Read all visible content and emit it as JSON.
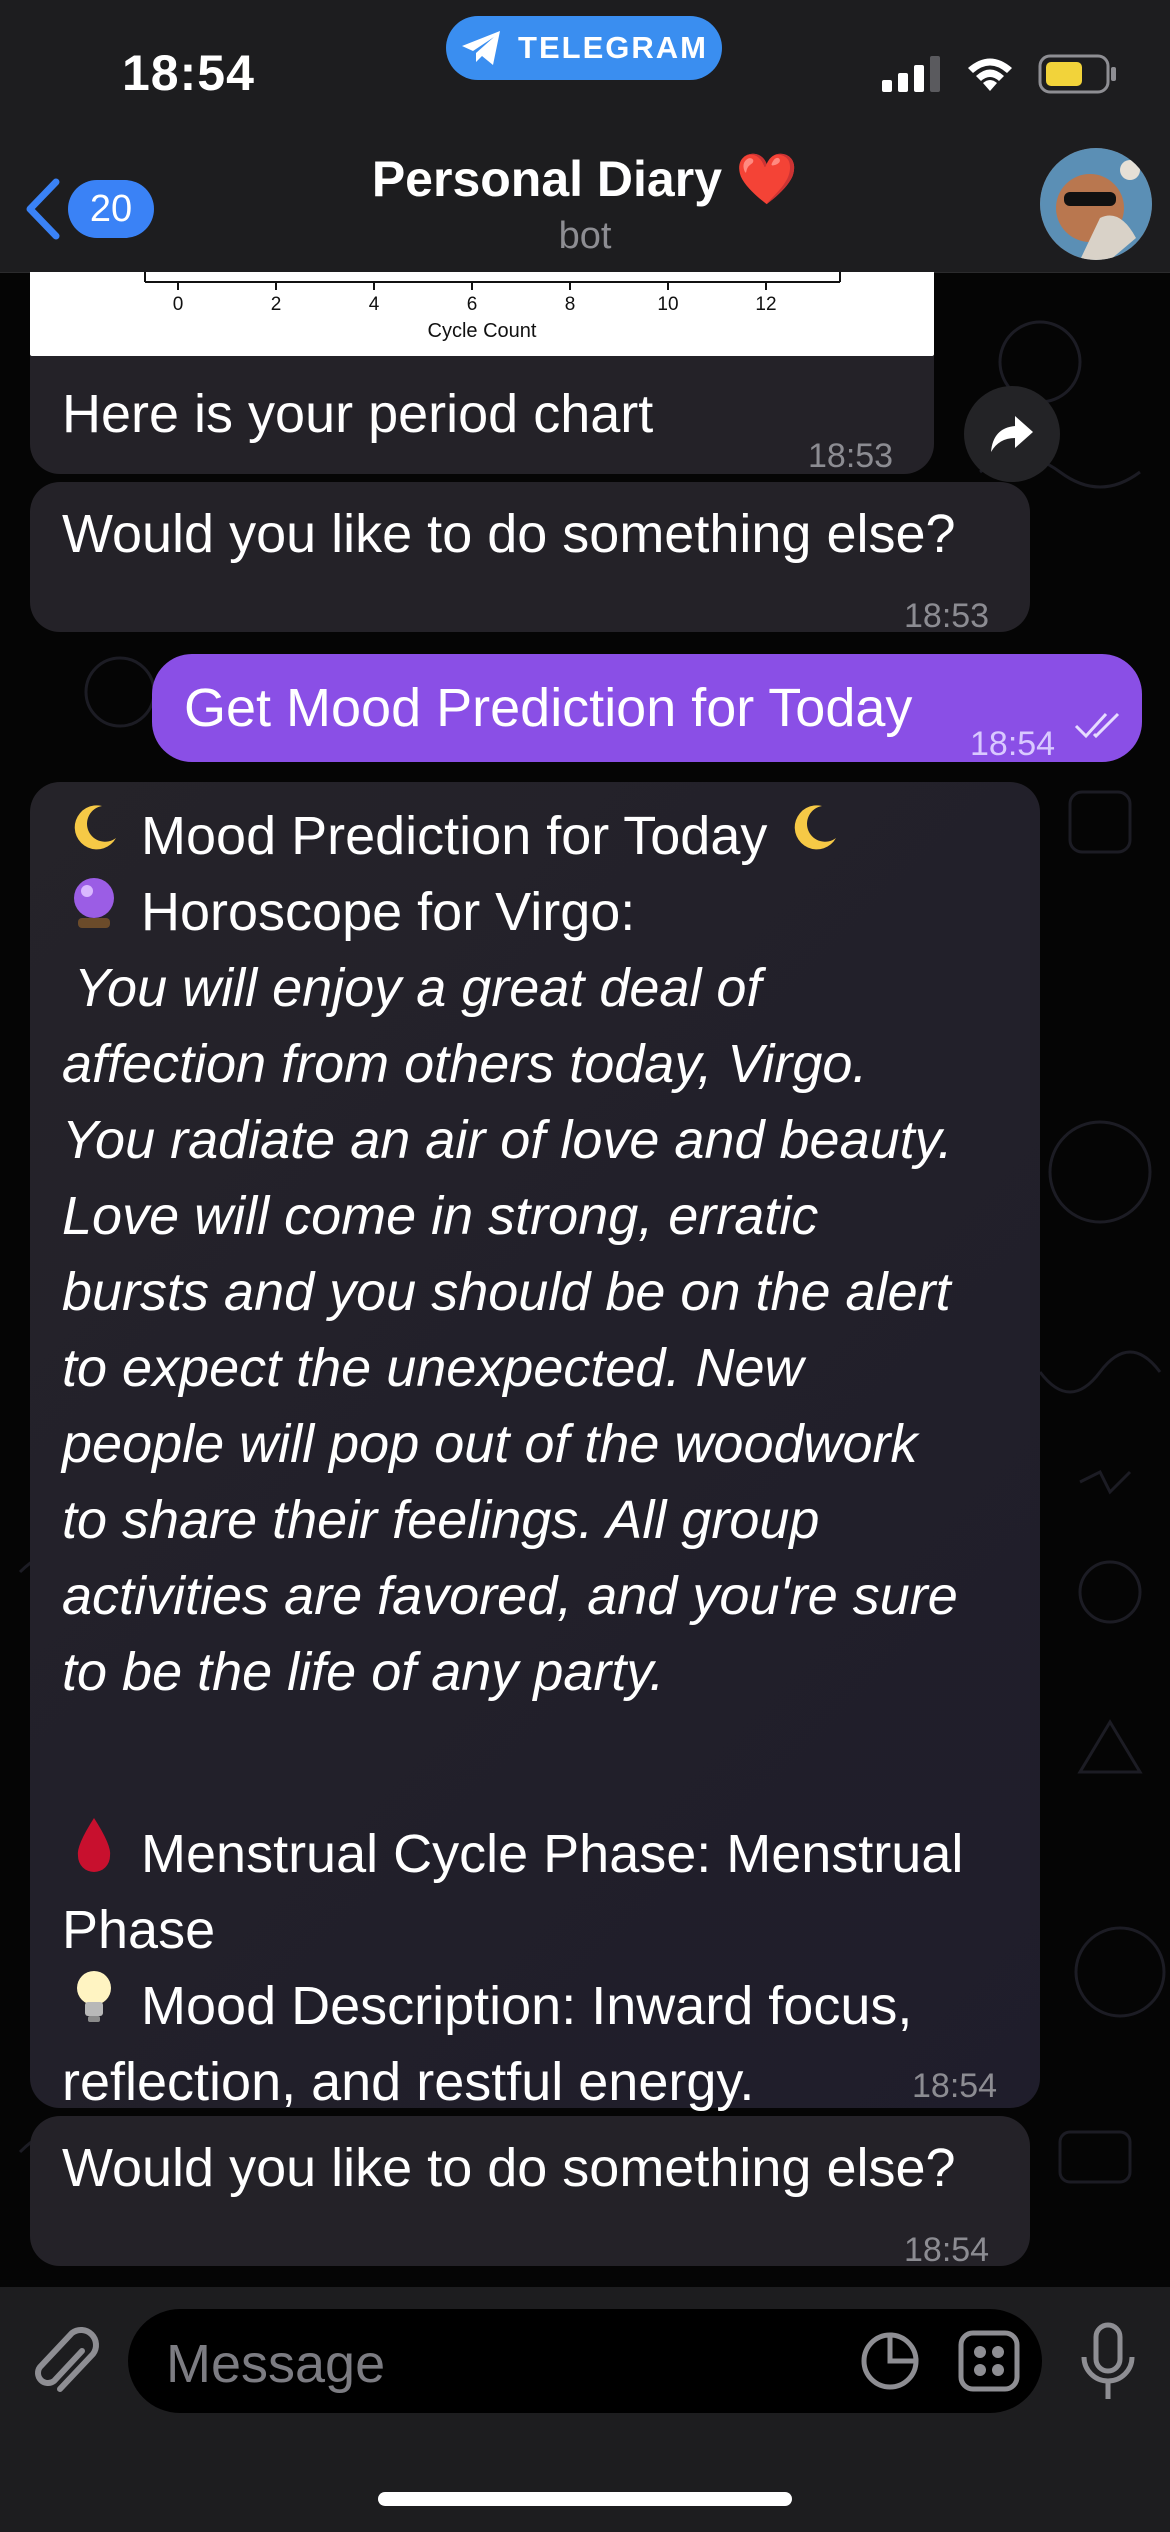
{
  "status_bar": {
    "time": "18:54",
    "app_pill": "TELEGRAM",
    "battery_color": "#f2d33a"
  },
  "header": {
    "back_count": "20",
    "title": "Personal Diary",
    "title_emoji": "❤️",
    "subtitle": "bot"
  },
  "chart_image": {
    "ticks": [
      "0",
      "2",
      "4",
      "6",
      "8",
      "10",
      "12"
    ],
    "xlabel": "Cycle Count"
  },
  "messages": {
    "chart_caption": {
      "text": "Here is your period chart",
      "time": "18:53"
    },
    "else1": {
      "text": "Would you like to do something else?",
      "time": "18:53"
    },
    "outgoing": {
      "text": "Get Mood Prediction for Today",
      "time": "18:54"
    },
    "prediction": {
      "heading": "Mood Prediction for Today",
      "horoscope_label": "Horoscope for Virgo:",
      "horoscope_lines": [
        "You will enjoy a great deal of",
        "affection from others today, Virgo.",
        "You radiate an air of love and beauty.",
        "Love will come in strong, erratic",
        "bursts and you should be on the alert",
        "to expect the unexpected. New",
        "people will pop out of the woodwork",
        "to share their feelings. All group",
        "activities are favored, and you're sure",
        "to be the life of any party."
      ],
      "phase_line1": "Menstrual Cycle Phase: Menstrual",
      "phase_line2": "Phase",
      "mood_line1": "Mood Description: Inward focus,",
      "mood_line2": "reflection, and restful energy.",
      "time": "18:54"
    },
    "else2": {
      "text": "Would you like to do something else?",
      "time": "18:54"
    }
  },
  "input": {
    "placeholder": "Message"
  },
  "colors": {
    "outgoing_bubble": "#8a4fe6",
    "incoming_bubble": "#242228",
    "accent": "#3a82f6"
  }
}
